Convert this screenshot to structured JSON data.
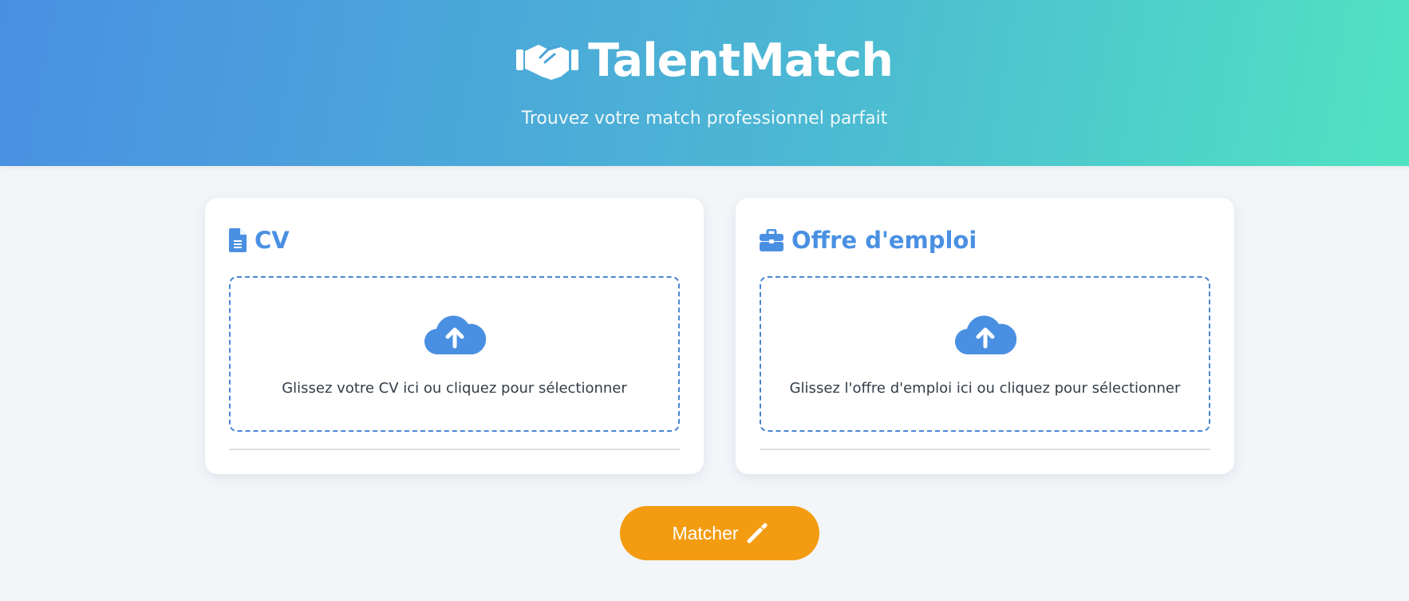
{
  "app": {
    "title": "TalentMatch",
    "subtitle": "Trouvez votre match professionnel parfait",
    "logo_icon": "handshake-icon"
  },
  "colors": {
    "header_gradient_start": "#4a90e2",
    "header_gradient_end": "#50e3c2",
    "accent": "#4a90e2",
    "button": "#f39c12",
    "background": "#f3f6f9"
  },
  "cards": {
    "cv": {
      "title": "CV",
      "title_icon": "file-icon",
      "dropzone_icon": "cloud-upload-icon",
      "dropzone_text": "Glissez votre CV ici ou cliquez pour sélectionner"
    },
    "job": {
      "title": "Offre d'emploi",
      "title_icon": "briefcase-icon",
      "dropzone_icon": "cloud-upload-icon",
      "dropzone_text": "Glissez l'offre d'emploi ici ou cliquez pour sélectionner"
    }
  },
  "actions": {
    "match_label": "Matcher",
    "match_icon": "magic-wand-icon"
  }
}
